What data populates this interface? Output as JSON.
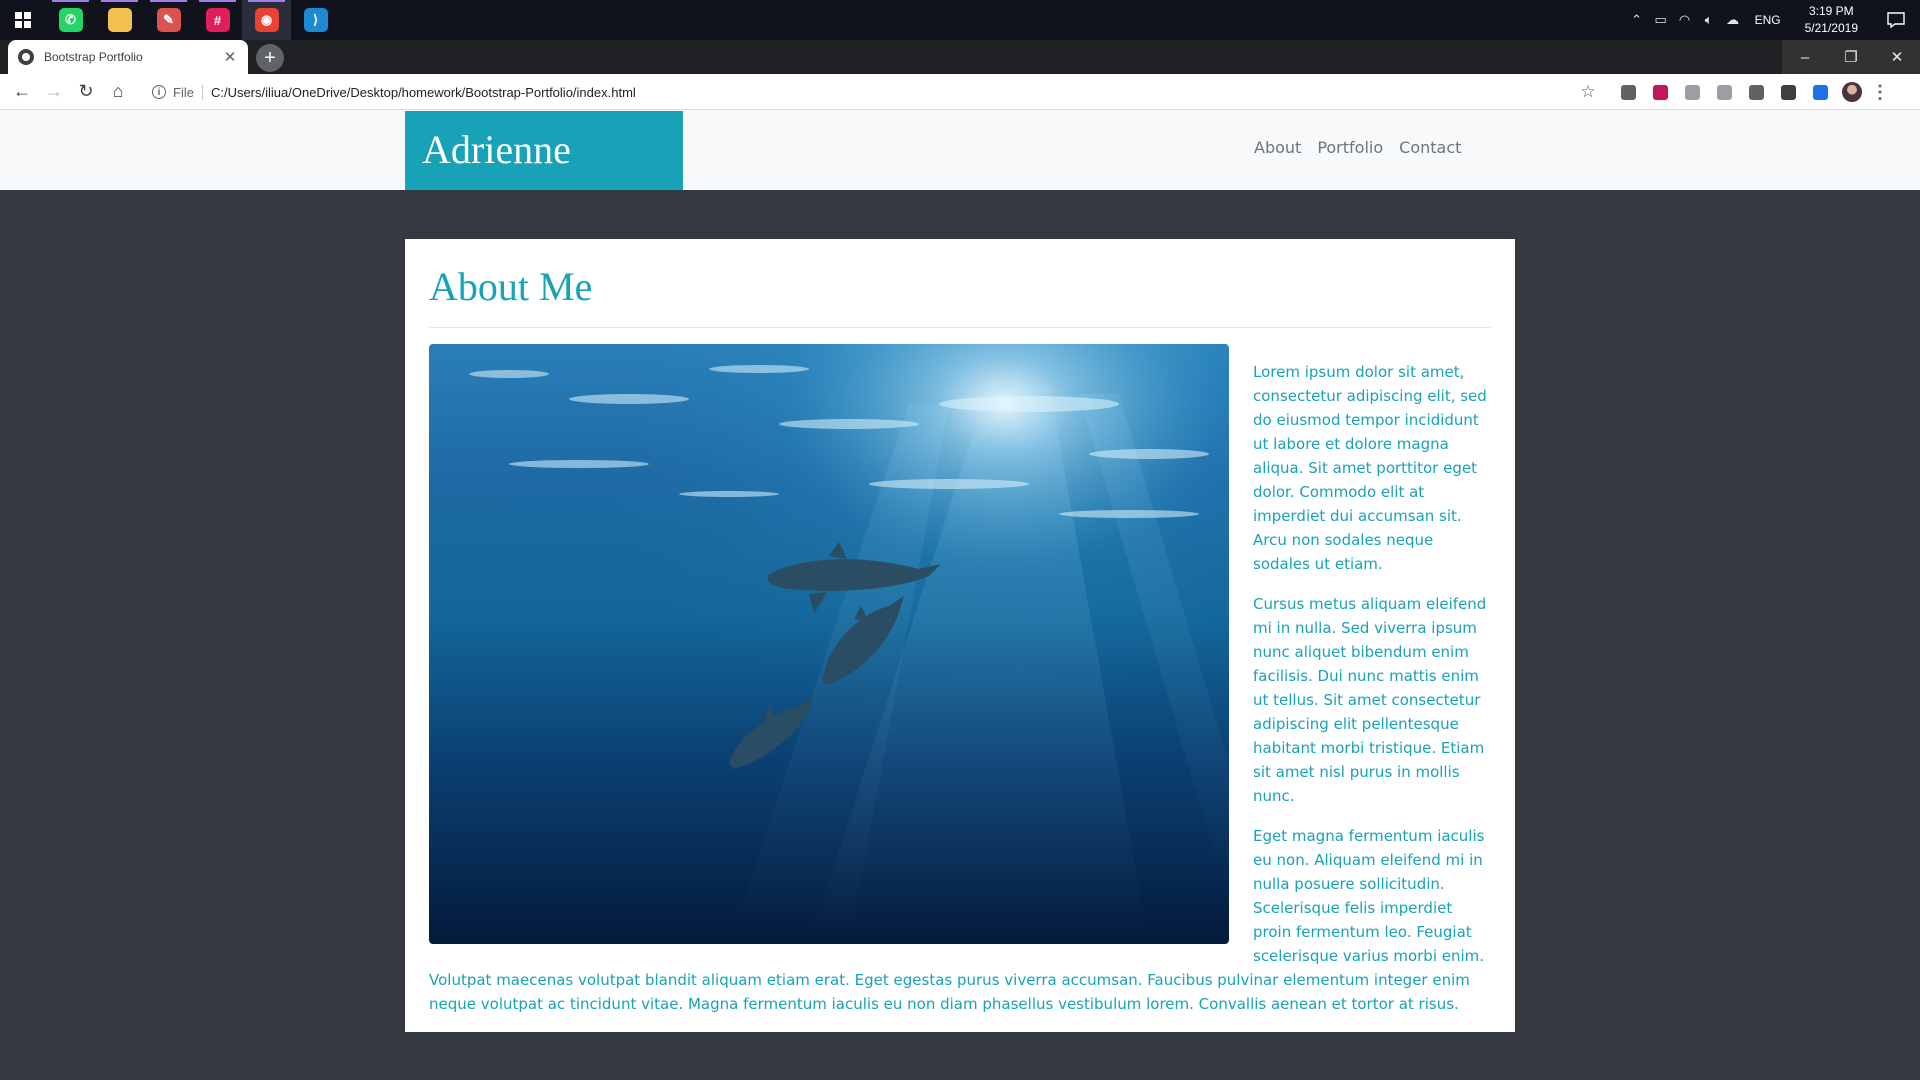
{
  "taskbar": {
    "apps": [
      {
        "name": "whatsapp",
        "icon": "whatsapp-icon",
        "color": "#25d366",
        "glyph": "✆"
      },
      {
        "name": "file-explorer",
        "icon": "folder-icon",
        "color": "#f2c14e",
        "glyph": ""
      },
      {
        "name": "paint",
        "icon": "palette-icon",
        "color": "#d9534f",
        "glyph": "✎"
      },
      {
        "name": "slack",
        "icon": "slack-icon",
        "color": "#e01e5a",
        "glyph": "#"
      },
      {
        "name": "chrome",
        "icon": "chrome-icon",
        "color": "#ea4335",
        "glyph": "◉"
      },
      {
        "name": "vscode",
        "icon": "vscode-icon",
        "color": "#1f8ad2",
        "glyph": "⟩"
      }
    ],
    "language": "ENG",
    "time": "3:19 PM",
    "date": "5/21/2019"
  },
  "browser": {
    "tab_title": "Bootstrap Portfolio",
    "address_prefix": "File",
    "url": "C:/Users/iliua/OneDrive/Desktop/homework/Bootstrap-Portfolio/index.html",
    "extensions": [
      {
        "icon": "shield-extension-icon",
        "color": "#5f6368"
      },
      {
        "icon": "purple-extension-icon",
        "color": "#c2185b"
      },
      {
        "icon": "grey-extension-icon",
        "color": "#9aa0a6"
      },
      {
        "icon": "puzzle-extension-icon",
        "color": "#9aa0a6"
      },
      {
        "icon": "film-extension-icon",
        "color": "#5f6368"
      },
      {
        "icon": "screenshot-extension-icon",
        "color": "#3c4043"
      },
      {
        "icon": "arrow-extension-icon",
        "color": "#1a73e8"
      }
    ]
  },
  "site": {
    "brand": "Adrienne",
    "brand_color": "#17a2b8",
    "nav": [
      "About",
      "Portfolio",
      "Contact"
    ],
    "about": {
      "title": "About Me",
      "image": "underwater-dolphins-photo",
      "paragraphs": [
        "Lorem ipsum dolor sit amet, consectetur adipiscing elit, sed do eiusmod tempor incididunt ut labore et dolore magna aliqua. Sit amet porttitor eget dolor. Commodo elit at imperdiet dui accumsan sit. Arcu non sodales neque sodales ut etiam.",
        "Cursus metus aliquam eleifend mi in nulla. Sed viverra ipsum nunc aliquet bibendum enim facilisis. Dui nunc mattis enim ut tellus. Sit amet consectetur adipiscing elit pellentesque habitant morbi tristique. Etiam sit amet nisl purus in mollis nunc.",
        "Eget magna fermentum iaculis eu non. Aliquam eleifend mi in nulla posuere sollicitudin. Scelerisque felis imperdiet proin fermentum leo. Feugiat scelerisque varius morbi enim. Volutpat maecenas volutpat blandit aliquam etiam erat. Eget egestas purus viverra accumsan. Faucibus pulvinar elementum integer enim neque volutpat ac tincidunt vitae. Magna fermentum iaculis eu non diam phasellus vestibulum lorem. Convallis aenean et tortor at risus."
      ]
    }
  }
}
